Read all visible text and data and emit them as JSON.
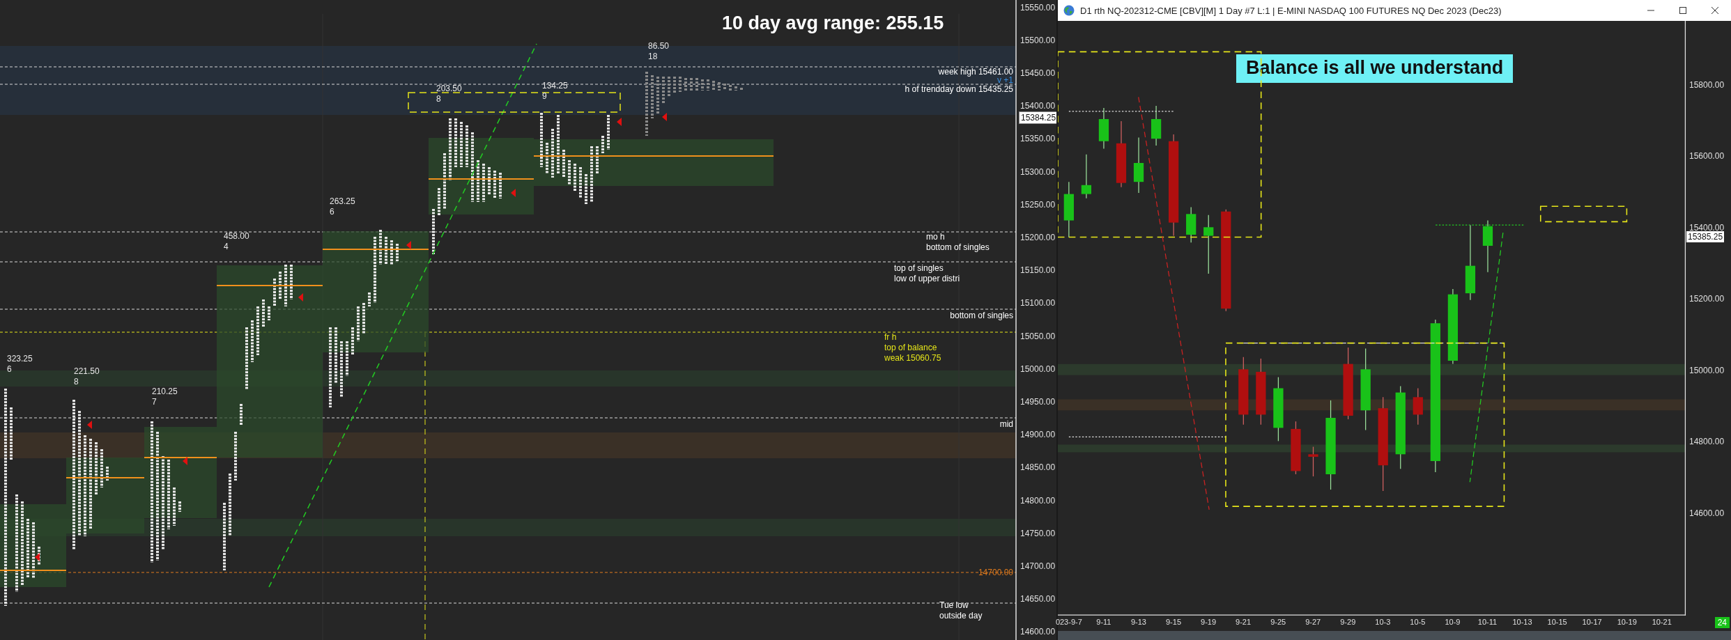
{
  "profile_chart": {
    "headline": "10 day avg range:  255.15",
    "profile_labels": [
      {
        "range": "323.25",
        "count": "6"
      },
      {
        "range": "221.50",
        "count": "8"
      },
      {
        "range": "210.25",
        "count": "7"
      },
      {
        "range": "458.00",
        "count": "4"
      },
      {
        "range": "263.25",
        "count": "6"
      },
      {
        "range": "203.50",
        "count": "8"
      },
      {
        "range": "134.25",
        "count": "9"
      },
      {
        "range": "86.50",
        "count": "18"
      }
    ],
    "levels": [
      {
        "lines": [
          "week high  15461.00"
        ],
        "color": "#ffffff"
      },
      {
        "lines": [
          "v +1"
        ],
        "color": "#3a8fe0"
      },
      {
        "lines": [
          "h of trendday down  15435.25"
        ],
        "color": "#ffffff"
      },
      {
        "lines": [
          "mo h",
          "bottom of singles"
        ],
        "color": "#ffffff"
      },
      {
        "lines": [
          "top of singles",
          "low of upper distri"
        ],
        "color": "#ffffff"
      },
      {
        "lines": [
          "bottom of singles"
        ],
        "color": "#ffffff"
      },
      {
        "lines": [
          "fr h",
          "top of balance",
          "weak  15060.75"
        ],
        "color": "#e6e619"
      },
      {
        "lines": [
          "mid"
        ],
        "color": "#ffffff"
      },
      {
        "lines": [
          "14700.00"
        ],
        "color": "#e07a1c"
      },
      {
        "lines": [
          "Tue low",
          "outside day"
        ],
        "color": "#ffffff"
      }
    ],
    "price_axis": [
      "15550.00",
      "15500.00",
      "15450.00",
      "15400.00",
      "15350.00",
      "15300.00",
      "15250.00",
      "15200.00",
      "15150.00",
      "15100.00",
      "15050.00",
      "15000.00",
      "14950.00",
      "14900.00",
      "14850.00",
      "14800.00",
      "14750.00",
      "14700.00",
      "14650.00",
      "14600.00"
    ],
    "last_price": "15384.25"
  },
  "chart_window": {
    "title": "D1 rth NQ-202312-CME [CBV][M]  1 Day  #7 L:1 | E-MINI NASDAQ 100 FUTURES NQ Dec 2023 (Dec23)",
    "callout": "Balance is all we understand",
    "last_price": "15385.25",
    "badge": "24",
    "chart_data": {
      "type": "candlestick",
      "categories": [
        "023-9-7",
        null,
        "9-11",
        null,
        "9-13",
        null,
        "9-15",
        null,
        "9-19",
        null,
        "9-21",
        null,
        "9-25",
        null,
        "9-27",
        null,
        "9-29",
        null,
        "10-3",
        null,
        "10-5",
        null,
        "10-9",
        null,
        "10-11",
        null,
        "10-13",
        null,
        "10-15",
        null,
        "10-17",
        null,
        "10-19",
        null,
        "10-21"
      ],
      "ohlc": [
        [
          15420,
          15528,
          15373,
          15494
        ],
        [
          15494,
          15605,
          15482,
          15519
        ],
        [
          15642,
          15735,
          15621,
          15704
        ],
        [
          15636,
          15698,
          15513,
          15525
        ],
        [
          15528,
          15652,
          15497,
          15581
        ],
        [
          15649,
          15741,
          15630,
          15704
        ],
        [
          15642,
          15661,
          15377,
          15414
        ],
        [
          15380,
          15457,
          15358,
          15438
        ],
        [
          15377,
          15435,
          15271,
          15401
        ],
        [
          15445,
          15451,
          15166,
          15173
        ],
        [
          15003,
          15037,
          14848,
          14876
        ],
        [
          14996,
          15033,
          14848,
          14876
        ],
        [
          14839,
          14981,
          14802,
          14950
        ],
        [
          14836,
          14857,
          14709,
          14718
        ],
        [
          14765,
          14786,
          14703,
          14758
        ],
        [
          14709,
          14916,
          14666,
          14867
        ],
        [
          15018,
          15064,
          14863,
          14873
        ],
        [
          14888,
          15061,
          14833,
          15003
        ],
        [
          14894,
          14925,
          14662,
          14734
        ],
        [
          14765,
          14956,
          14724,
          14938
        ],
        [
          14925,
          14950,
          14848,
          14876
        ],
        [
          14746,
          15142,
          14715,
          15132
        ],
        [
          15027,
          15228,
          15018,
          15213
        ],
        [
          15216,
          15407,
          15197,
          15293
        ],
        [
          15349,
          15420,
          15275,
          15404
        ],
        null,
        null,
        null,
        null,
        null,
        null,
        null,
        null,
        null,
        null
      ],
      "ylim": [
        14313,
        15979
      ],
      "yticks": [
        {
          "value": 15800,
          "label": "15800.00"
        },
        {
          "value": 15600,
          "label": "15600.00"
        },
        {
          "value": 15400,
          "label": "15400.00"
        },
        {
          "value": 15200,
          "label": "15200.00"
        },
        {
          "value": 15000,
          "label": "15000.00"
        },
        {
          "value": 14800,
          "label": "14800.00"
        },
        {
          "value": 14600,
          "label": "14600.00"
        }
      ]
    }
  }
}
